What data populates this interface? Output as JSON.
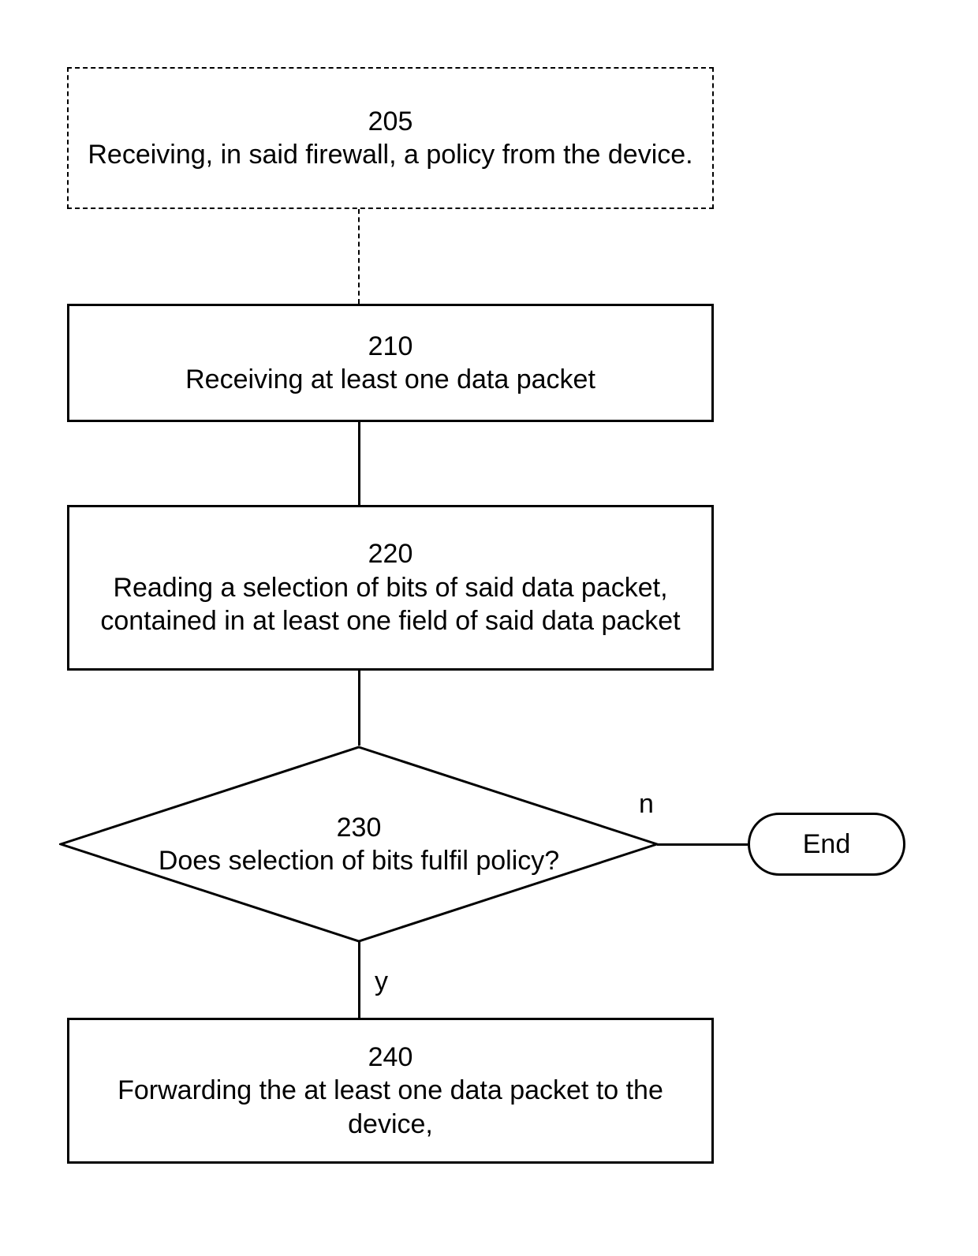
{
  "nodes": {
    "n205": {
      "num": "205",
      "text": "Receiving, in said firewall, a policy from the device."
    },
    "n210": {
      "num": "210",
      "text": "Receiving at least one data packet"
    },
    "n220": {
      "num": "220",
      "text": "Reading a selection of bits of said data packet, contained in at least one field of said data packet"
    },
    "n230": {
      "num": "230",
      "text": "Does selection of bits fulfil policy?"
    },
    "n240": {
      "num": "240",
      "text": "Forwarding the at least one data packet to the device,"
    },
    "end": {
      "text": "End"
    }
  },
  "branches": {
    "no": "n",
    "yes": "y"
  }
}
